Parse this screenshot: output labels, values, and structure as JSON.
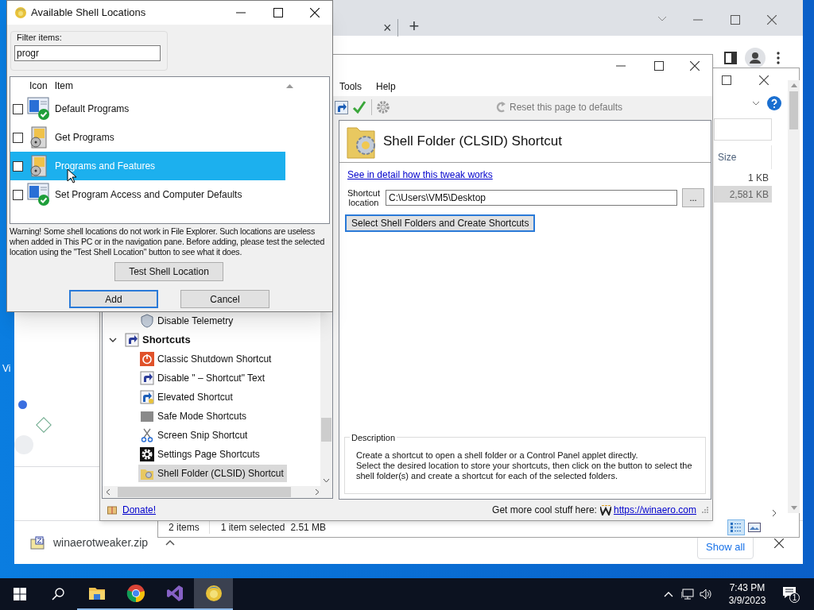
{
  "desktop": {
    "icon_labels": [
      {
        "text": "Vi"
      }
    ]
  },
  "browser": {
    "tab_close": "×",
    "new_tab": "+",
    "downloads": {
      "file": "winaerotweaker.zip",
      "show_all": "Show all"
    }
  },
  "explorer": {
    "column": "Size",
    "rows": [
      {
        "size": "1 KB",
        "selected": false
      },
      {
        "size": "2,581 KB",
        "selected": true
      }
    ],
    "status": [
      "2 items",
      "1 item selected",
      "2.51 MB"
    ]
  },
  "tweaker": {
    "menu": [
      "Tools",
      "Help"
    ],
    "reset": "Reset this page to defaults",
    "tree": [
      {
        "children": [
          {
            "label": "Disable Telemetry",
            "selected": false
          }
        ]
      },
      {
        "label": "Shortcuts",
        "expanded": true,
        "selected": false,
        "children": [
          {
            "label": "Classic Shutdown Shortcut",
            "selected": false
          },
          {
            "label": "Disable \" – Shortcut\" Text",
            "selected": false
          },
          {
            "label": "Elevated Shortcut",
            "selected": false
          },
          {
            "label": "Safe Mode Shortcuts",
            "selected": false
          },
          {
            "label": "Screen Snip Shortcut",
            "selected": false
          },
          {
            "label": "Settings Page Shortcuts",
            "selected": false
          },
          {
            "label": "Shell Folder (CLSID) Shortcut",
            "selected": true
          }
        ]
      }
    ],
    "page": {
      "title": "Shell Folder (CLSID) Shortcut",
      "link": "See in detail how this tweak works",
      "location_label": "Shortcut location",
      "location_value": "C:\\Users\\VM5\\Desktop",
      "browse": "...",
      "action": "Select Shell Folders and Create Shortcuts",
      "description_title": "Description",
      "description": [
        "Create a shortcut to open a shell folder or a Control Panel applet directly.",
        "Select the desired location to store your shortcuts, then click on the button to select the shell folder(s) and create a shortcut for each of the selected folders."
      ]
    },
    "footer": {
      "donate": "Donate!",
      "promo": "Get more cool stuff here:",
      "link": "https://winaero.com"
    }
  },
  "dialog": {
    "title": "Available Shell Locations",
    "filter_label": "Filter items:",
    "filter_value": "progr",
    "columns": [
      "Icon",
      "Item"
    ],
    "items": [
      {
        "label": "Default Programs",
        "checked": false,
        "selected": false
      },
      {
        "label": "Get Programs",
        "checked": false,
        "selected": false
      },
      {
        "label": "Programs and Features",
        "checked": false,
        "selected": true
      },
      {
        "label": "Set Program Access and Computer Defaults",
        "checked": false,
        "selected": false
      }
    ],
    "warning": "Warning! Some shell locations do not work in File Explorer. Such locations are useless when added in This PC or in the navigation pane. Before adding, please test the selected location using the \"Test Shell Location\" button to see what it does.",
    "buttons": [
      "Test Shell Location",
      "Add",
      "Cancel"
    ]
  },
  "taskbar": {
    "apps": [
      {
        "selected": false
      },
      {
        "selected": false
      },
      {
        "selected": false
      },
      {
        "selected": true
      }
    ],
    "time": "7:43 PM",
    "date": "3/9/2023",
    "notifications": "1"
  }
}
